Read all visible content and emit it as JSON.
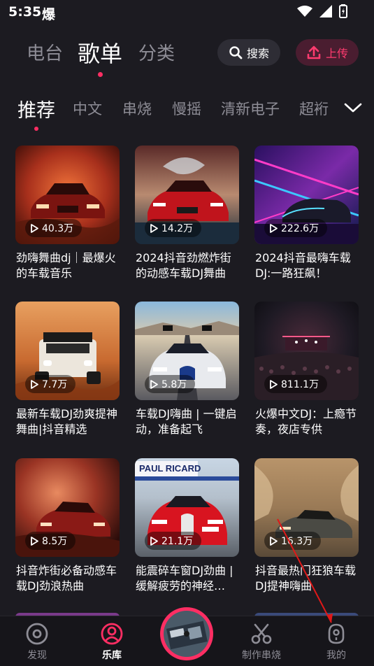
{
  "status_bar": {
    "time": "5:35",
    "notif_icon": "爆"
  },
  "header": {
    "tabs": [
      {
        "label": "电台",
        "active": false
      },
      {
        "label": "歌单",
        "active": true
      },
      {
        "label": "分类",
        "active": false
      }
    ],
    "search_label": "搜索",
    "upload_label": "上传"
  },
  "categories": [
    "推荐",
    "中文",
    "串烧",
    "慢摇",
    "清新电子",
    "超裄"
  ],
  "playlists": [
    {
      "play_count": "40.3万",
      "title": "劲嗨舞曲dj｜最爆火的车载音乐"
    },
    {
      "play_count": "14.2万",
      "title": "2024抖音劲燃炸街的动感车载DJ舞曲"
    },
    {
      "play_count": "222.6万",
      "title": "2024抖音最嗨车载DJ:一路狂飙！"
    },
    {
      "play_count": "7.7万",
      "title": "最新车载DJ劲爽提神舞曲|抖音精选"
    },
    {
      "play_count": "5.8万",
      "title": "车载DJ嗨曲 | 一键启动，准备起飞"
    },
    {
      "play_count": "811.1万",
      "title": "火爆中文DJ：上瘾节奏，夜店专供"
    },
    {
      "play_count": "8.5万",
      "title": "抖音炸街必备动感车载DJ劲浪热曲"
    },
    {
      "play_count": "21.1万",
      "title": "能震碎车窗DJ劲曲 | 缓解疲劳的神经…"
    },
    {
      "play_count": "16.3万",
      "title": "抖音最热门狂狼车载DJ提神嗨曲"
    }
  ],
  "thumb_text": {
    "sign": "PAUL RICARD"
  },
  "bottom_nav": [
    {
      "label": "发现",
      "icon": "discover-icon",
      "active": false
    },
    {
      "label": "乐库",
      "icon": "library-icon",
      "active": true
    },
    {
      "label": "制作串烧",
      "icon": "mix-icon",
      "active": false
    },
    {
      "label": "我的",
      "icon": "profile-icon",
      "active": false
    }
  ],
  "colors": {
    "accent": "#ff2e63",
    "background": "#1c1b21",
    "nav_background": "#16151a"
  }
}
